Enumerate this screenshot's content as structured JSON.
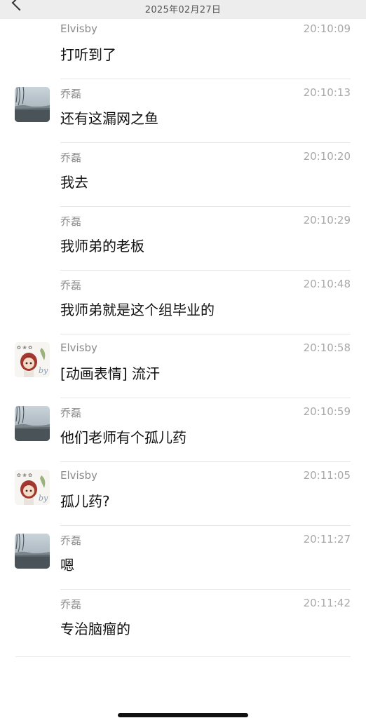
{
  "header": {
    "date": "2025年02月27日",
    "back_icon": "chevron-left-icon"
  },
  "messages": [
    {
      "sender": "Elvisby",
      "time": "20:10:09",
      "text": "打听到了",
      "avatar": "none"
    },
    {
      "sender": "乔磊",
      "time": "20:10:13",
      "text": "还有这漏网之鱼",
      "avatar": "landscape"
    },
    {
      "sender": "乔磊",
      "time": "20:10:20",
      "text": "我去",
      "avatar": "none"
    },
    {
      "sender": "乔磊",
      "time": "20:10:29",
      "text": "我师弟的老板",
      "avatar": "none"
    },
    {
      "sender": "乔磊",
      "time": "20:10:48",
      "text": "我师弟就是这个组毕业的",
      "avatar": "none"
    },
    {
      "sender": "Elvisby",
      "time": "20:10:58",
      "text": "[动画表情] 流汗",
      "avatar": "anime"
    },
    {
      "sender": "乔磊",
      "time": "20:10:59",
      "text": "他们老师有个孤儿药",
      "avatar": "landscape"
    },
    {
      "sender": "Elvisby",
      "time": "20:11:05",
      "text": "孤儿药?",
      "avatar": "anime"
    },
    {
      "sender": "乔磊",
      "time": "20:11:27",
      "text": "嗯",
      "avatar": "landscape"
    },
    {
      "sender": "乔磊",
      "time": "20:11:42",
      "text": "专治脑瘤的",
      "avatar": "none"
    }
  ],
  "colors": {
    "background": "#ffffff",
    "header_bg": "#ededed",
    "sender": "#8a8a8a",
    "timestamp": "#a8a8a8",
    "divider": "#e6e6e6"
  }
}
